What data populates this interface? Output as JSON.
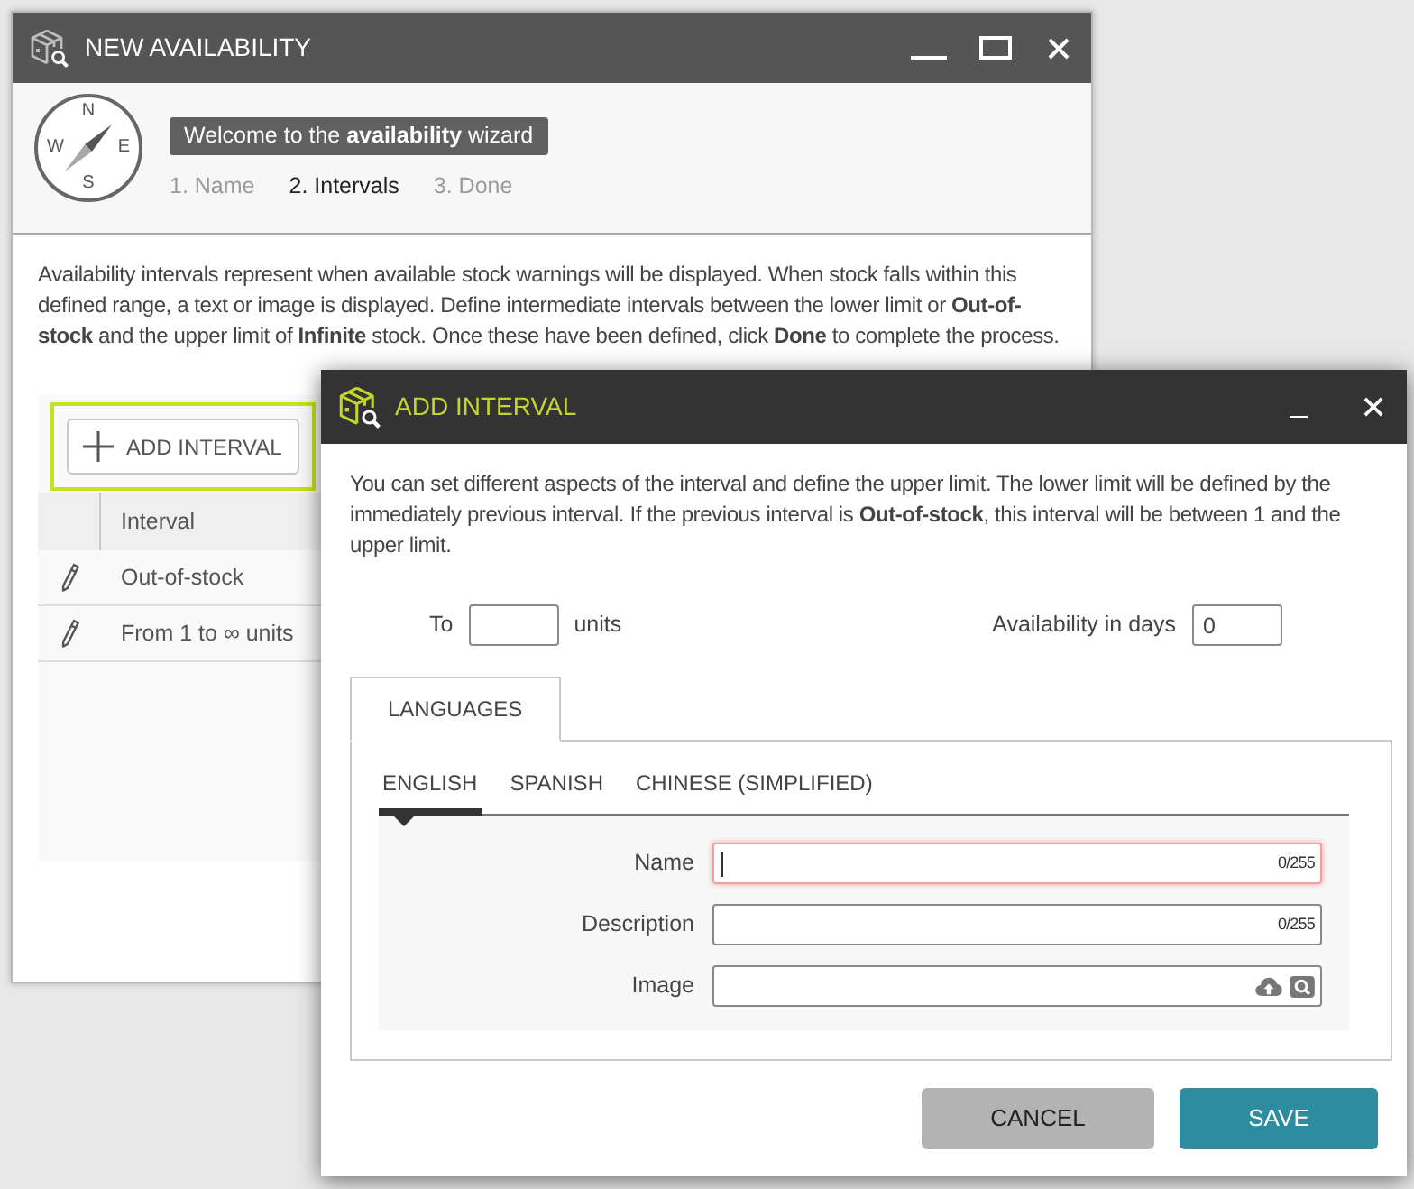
{
  "main_window": {
    "title": "NEW AVAILABILITY",
    "wizard": {
      "compass_letters": [
        "N",
        "W",
        "E",
        "S"
      ],
      "welcome": "Welcome to the **availability** wizard",
      "steps": [
        {
          "label": "1. Name",
          "selected": false
        },
        {
          "label": "2. Intervals",
          "selected": true
        },
        {
          "label": "3. Done",
          "selected": false
        }
      ]
    },
    "description": "Availability intervals represent when available stock warnings will be displayed. When stock falls within this defined range, a text or image is displayed. Define intermediate intervals between the lower limit or **Out-of-stock** and the upper limit of **Infinite** stock. Once these have been defined, click **Done** to complete the process.",
    "add_button": {
      "label": "ADD INTERVAL",
      "highlighted": true
    },
    "table": {
      "columns": [
        "Interval"
      ],
      "rows": [
        {
          "interval": "Out-of-stock"
        },
        {
          "interval": "From 1 to ∞ units"
        }
      ]
    }
  },
  "dialog": {
    "title": "ADD INTERVAL",
    "description": "You can set different aspects of the interval and define the upper limit. The lower limit will be defined by the immediately previous interval. If the previous interval is **Out-of-stock**, this interval will be between 1 and the upper limit.",
    "to_label": "To",
    "units_label": "units",
    "availability_label": "Availability in days",
    "availability_value": "0",
    "section_tabs": [
      {
        "label": "LANGUAGES",
        "selected": true
      }
    ],
    "language_tabs": [
      {
        "label": "ENGLISH",
        "selected": true
      },
      {
        "label": "SPANISH",
        "selected": false
      },
      {
        "label": "CHINESE (SIMPLIFIED)",
        "selected": false
      }
    ],
    "fields": [
      {
        "kind": "text",
        "label": "Name",
        "counter": "0/255",
        "focused": true
      },
      {
        "kind": "text",
        "label": "Description",
        "counter": "0/255",
        "focused": false
      },
      {
        "kind": "image",
        "label": "Image",
        "focused": false
      }
    ],
    "buttons": [
      {
        "kind": "secondary",
        "label": "CANCEL"
      },
      {
        "kind": "primary",
        "label": "SAVE"
      }
    ]
  }
}
